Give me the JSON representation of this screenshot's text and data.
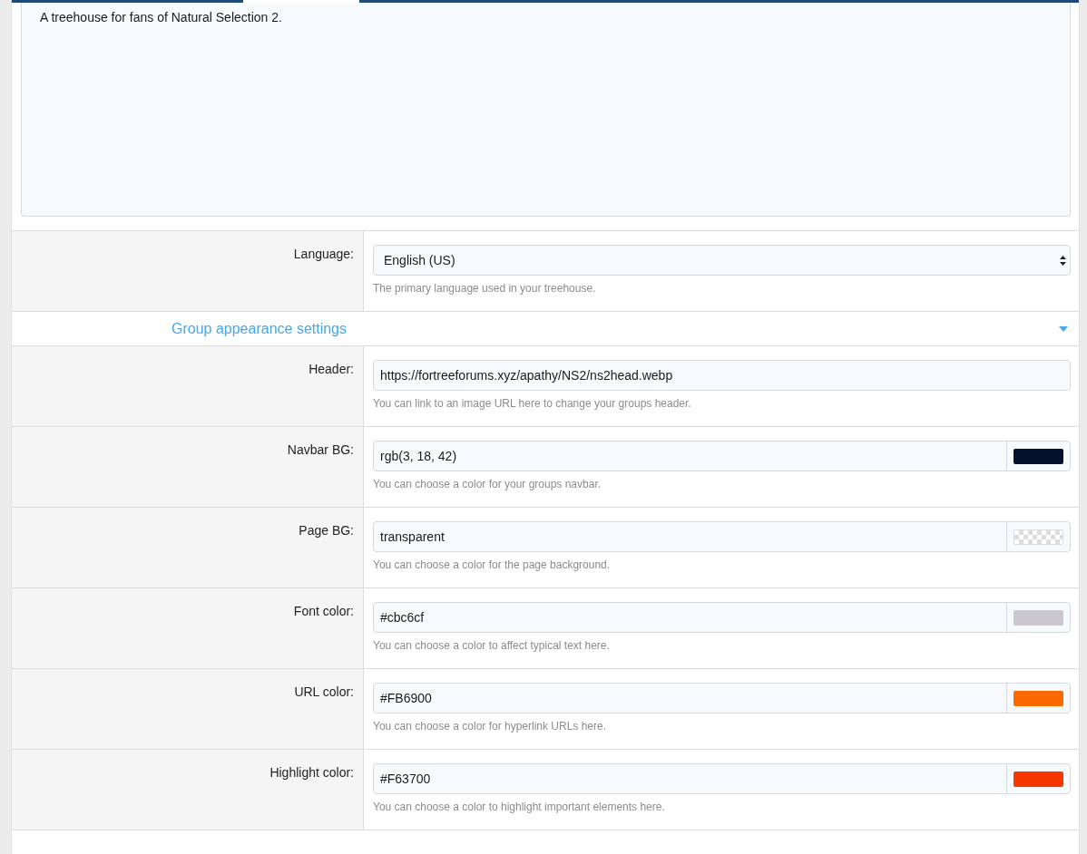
{
  "description": {
    "value": "A treehouse for fans of Natural Selection 2."
  },
  "language": {
    "label": "Language:",
    "value": "English (US)",
    "hint": "The primary language used in your treehouse."
  },
  "section": {
    "title": "Group appearance settings",
    "expanded": true
  },
  "fields": [
    {
      "kind": "text",
      "label": "Header:",
      "value": "https://fortreeforums.xyz/apathy/NS2/ns2head.webp",
      "hint": "You can link to an image URL here to change your groups header."
    },
    {
      "kind": "color",
      "label": "Navbar BG:",
      "value": "rgb(3, 18, 42)",
      "color": "#03122a",
      "hint": "You can choose a color for your groups navbar."
    },
    {
      "kind": "transparent",
      "label": "Page BG:",
      "value": "transparent",
      "hint": "You can choose a color for the page background."
    },
    {
      "kind": "color",
      "label": "Font color:",
      "value": "#cbc6cf",
      "color": "#cbc6cf",
      "hint": "You can choose a color to affect typical text here."
    },
    {
      "kind": "color",
      "label": "URL color:",
      "value": "#FB6900",
      "color": "#fb6900",
      "hint": "You can choose a color for hyperlink URLs here."
    },
    {
      "kind": "color",
      "label": "Highlight color:",
      "value": "#F63700",
      "color": "#f63700",
      "hint": "You can choose a color to highlight important elements here."
    }
  ]
}
